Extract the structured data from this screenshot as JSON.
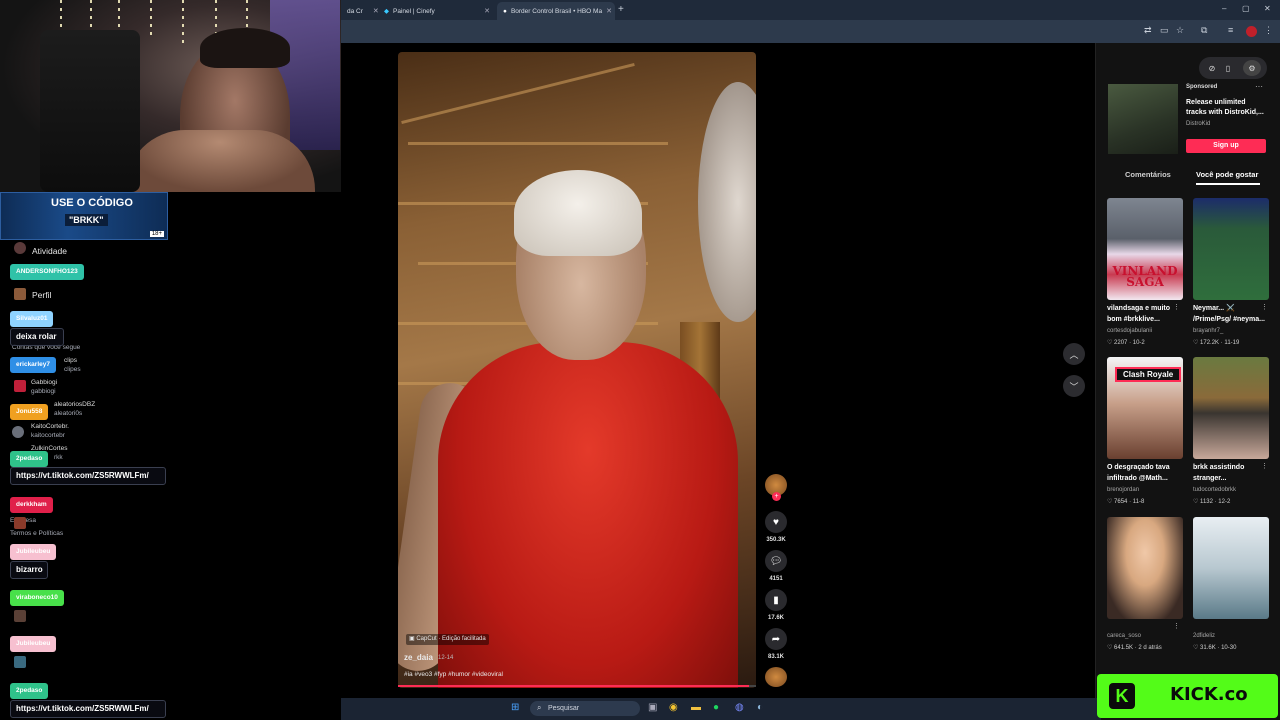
{
  "browser": {
    "tabs": [
      {
        "label": "da Cr",
        "active": false
      },
      {
        "label": "Painel | Cinefy",
        "active": false
      },
      {
        "label": "Border Control Brasil • HBO Ma",
        "active": true
      }
    ],
    "new_tab": "+",
    "win_min": "–",
    "win_max": "▢",
    "win_close": "✕"
  },
  "promo": {
    "line1": "USE O CÓDIGO",
    "line2": "\"BRKK\"",
    "age": "18+"
  },
  "chat": [
    {
      "user": "ANDERSONFHO123",
      "color": "#2fc2a8",
      "message": ""
    },
    {
      "user": "Silvaluz01",
      "color": "#8fd3ff",
      "message": "deixa rolar"
    },
    {
      "user": "erickarley7",
      "color": "#2f8fe6",
      "message": ""
    },
    {
      "user": "Jonu558",
      "color": "#f0a020",
      "message": ""
    },
    {
      "user": "2pedaso",
      "color": "#2fc28a",
      "message": "https://vt.tiktok.com/ZS5RWWLFm/"
    },
    {
      "user": "derkkham",
      "color": "#e0204a",
      "message": ""
    },
    {
      "user": "Jubileubeu",
      "color": "#f7c0d0",
      "message": "bizarro"
    },
    {
      "user": "viraboneco10",
      "color": "#48e04a",
      "message": ""
    },
    {
      "user": "Jubileubeu",
      "color": "#f7c0d0",
      "message": ""
    },
    {
      "user": "2pedaso",
      "color": "#2fc28a",
      "message": "https://vt.tiktok.com/ZS5RWWLFm/"
    }
  ],
  "sidebar_ghost": {
    "atividade": "Atividade",
    "perfil": "Perfil",
    "contas": "Contas que você segue",
    "clips1": "clips",
    "clips2": "clipes",
    "gabbiogi1": "Gabbiogi",
    "gabbiogi2": "gabbiogi",
    "aleatorios1": "aleatoriosDBZ",
    "aleatorios2": "aleatori0s",
    "kaito1": "KaitoCortebr.",
    "kaito2": "kaitocortebr",
    "zulkin": "ZulkinCortes",
    "rkk": "rkk",
    "empresa": "Empresa",
    "termos": "Termos e Políticas"
  },
  "video": {
    "author": "ze_daia",
    "date": "12-14",
    "hashtags": "#ia #veo3 #fyp #humor #videoviral",
    "capcut": "CapCut · Edição facilitada",
    "progress": 0.98
  },
  "rail": {
    "likes": "350.3K",
    "comments": "4151",
    "saves": "17.6K",
    "shares": "83.1K"
  },
  "ad": {
    "label": "Sponsored",
    "title": "Release unlimited tracks with DistroKid,...",
    "brand": "DistroKid",
    "cta": "Sign up",
    "more": "···"
  },
  "right_tabs": {
    "comments": "Comentários",
    "suggested": "Você pode gostar"
  },
  "cards": [
    {
      "title": "vilandsaga e muito bom #brkklive...",
      "user": "cortesdojabulanii",
      "likes": "2207",
      "date": "10-2"
    },
    {
      "title": "Neymar... ⚔️ /Prime/Psg/ #neyma...",
      "user": "brayanhr7_",
      "likes": "172.2K",
      "date": "11-19"
    },
    {
      "title": "O desgraçado tava infiltrado @Math...",
      "user": "brenojordan",
      "likes": "7654",
      "date": "11-8"
    },
    {
      "title": "brkk assistindo stranger...",
      "user": "tudocortedobrkk",
      "likes": "1132",
      "date": "12-2"
    },
    {
      "title": "",
      "user": "careca_soso",
      "likes": "641.5K",
      "date": "2 d atrás"
    },
    {
      "title": "",
      "user": "2dfideliz",
      "likes": "31.6K",
      "date": "10-30"
    }
  ],
  "card_overlays": {
    "vinland": "VINLAND SAGA",
    "clash": "Clash Royale"
  },
  "taskbar": {
    "search": "Pesquisar"
  },
  "kick": {
    "icon": "K",
    "text": "KICK.co"
  },
  "colors": {
    "accent": "#fe2c55",
    "kick": "#53fc18"
  }
}
